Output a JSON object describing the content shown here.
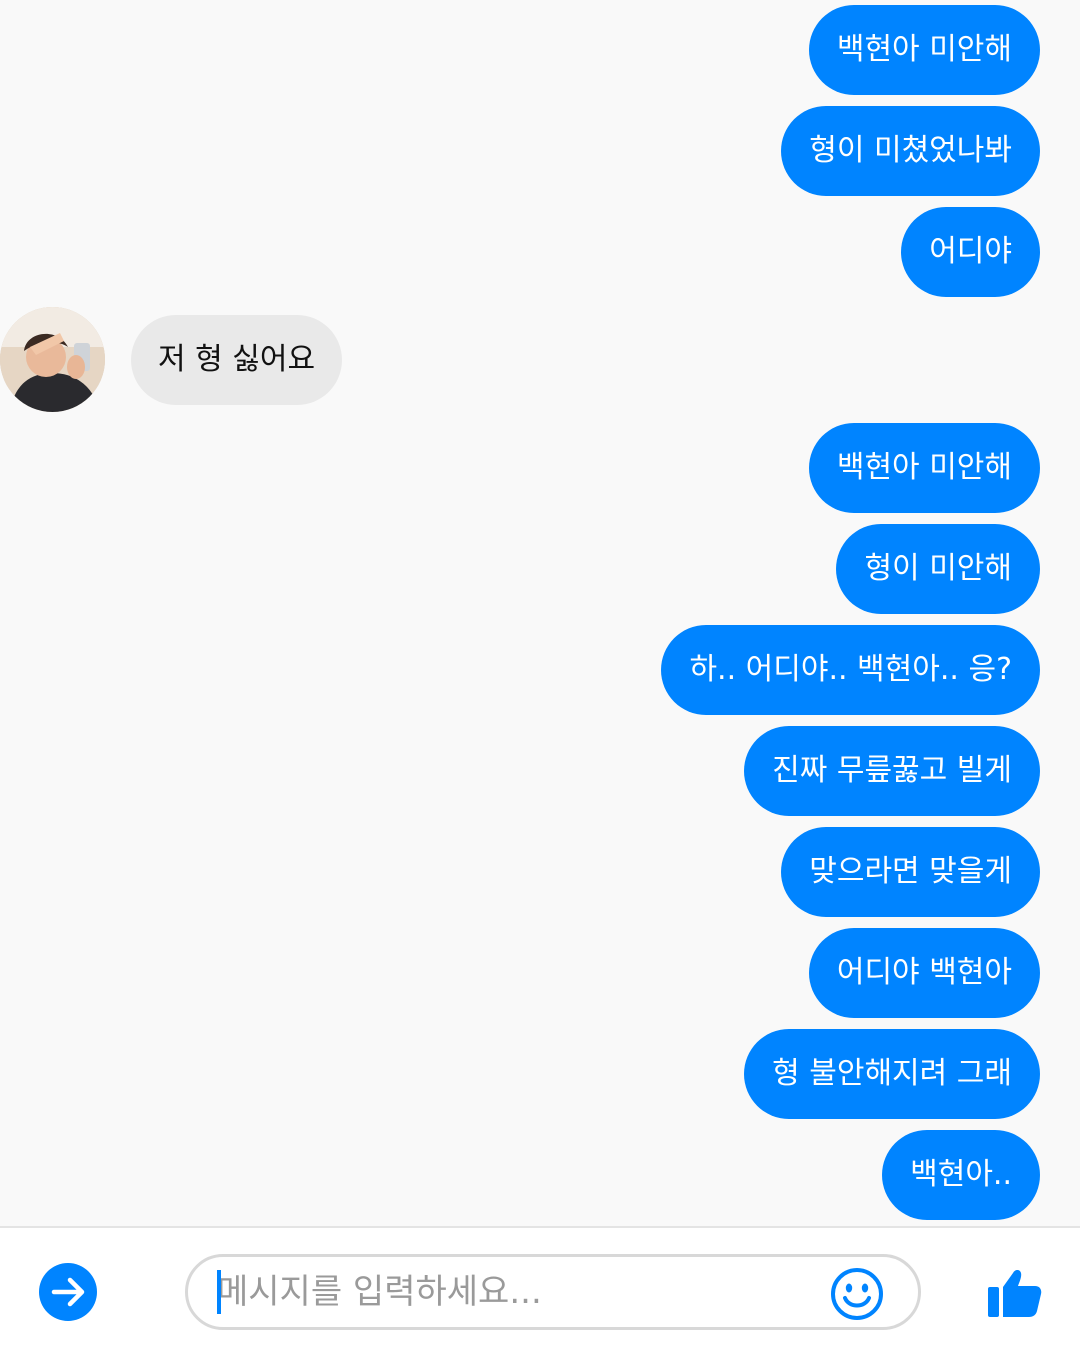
{
  "conversation": {
    "messages": [
      {
        "side": "out",
        "text": "백현아 미안해"
      },
      {
        "side": "out",
        "text": "형이 미쳤었나봐"
      },
      {
        "side": "out",
        "text": "어디야"
      },
      {
        "side": "in",
        "text": "저 형 싫어요"
      },
      {
        "side": "out",
        "text": "백현아 미안해"
      },
      {
        "side": "out",
        "text": "형이 미안해"
      },
      {
        "side": "out",
        "text": "하.. 어디야.. 백현아.. 응?"
      },
      {
        "side": "out",
        "text": "진짜 무릎꿇고 빌게"
      },
      {
        "side": "out",
        "text": "맞으라면 맞을게"
      },
      {
        "side": "out",
        "text": "어디야 백현아"
      },
      {
        "side": "out",
        "text": "형 불안해지려 그래"
      },
      {
        "side": "out",
        "text": "백현아.."
      }
    ]
  },
  "composer": {
    "placeholder": "메시지를 입력하세요...",
    "value": "",
    "send_icon": "arrow-right-circle-icon",
    "emoji_icon": "smiley-icon",
    "like_icon": "thumbs-up-icon"
  },
  "colors": {
    "accent": "#0084ff",
    "outgoing_bubble": "#0084ff",
    "incoming_bubble": "#e9e9e9",
    "background": "#f9f9f9"
  }
}
